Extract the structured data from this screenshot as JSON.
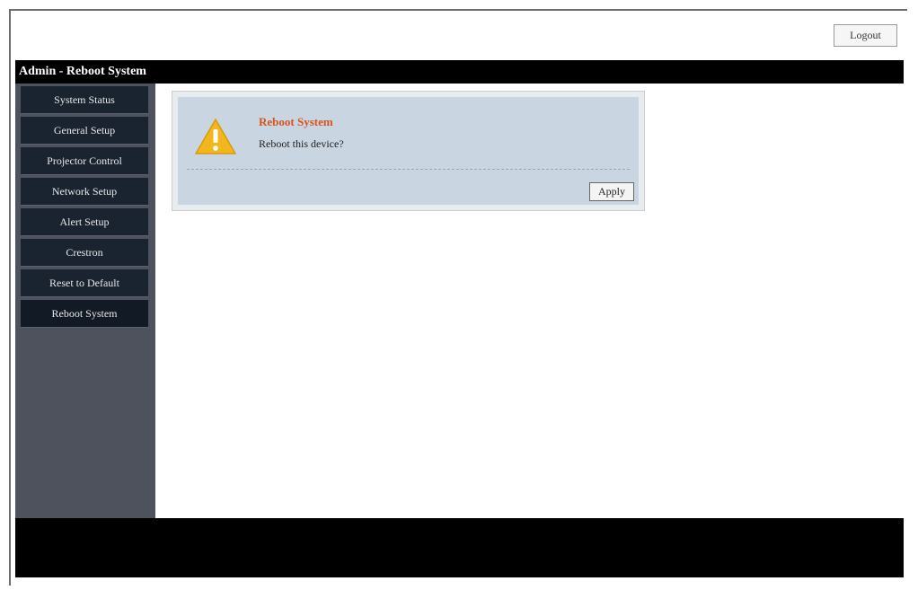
{
  "header": {
    "logout_label": "Logout"
  },
  "title_bar": {
    "text": "Admin - Reboot System"
  },
  "sidebar": {
    "items": [
      {
        "label": "System Status"
      },
      {
        "label": "General Setup"
      },
      {
        "label": "Projector Control"
      },
      {
        "label": "Network Setup"
      },
      {
        "label": "Alert Setup"
      },
      {
        "label": "Crestron"
      },
      {
        "label": "Reset to Default"
      },
      {
        "label": "Reboot System"
      }
    ],
    "active_index": 7
  },
  "dialog": {
    "title": "Reboot System",
    "message": "Reboot this device?",
    "apply_label": "Apply",
    "icon": "warning-icon"
  },
  "colors": {
    "title_accent": "#d8531e",
    "sidebar_bg": "#4d525c",
    "nav_item_bg": "#1a2330",
    "dialog_bg": "#c9d6e2",
    "warning_yellow": "#f2b71d"
  }
}
